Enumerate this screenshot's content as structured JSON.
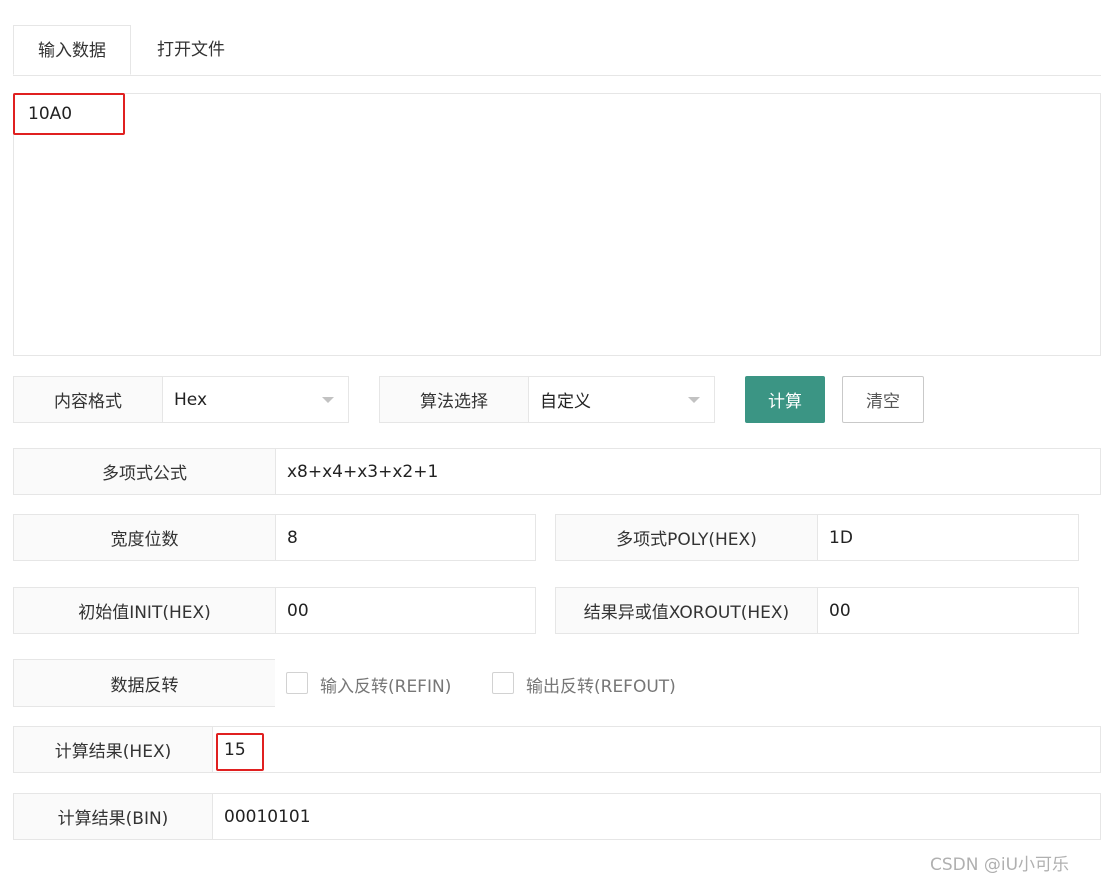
{
  "tabs": [
    {
      "label": "输入数据",
      "active": true
    },
    {
      "label": "打开文件",
      "active": false
    }
  ],
  "input": {
    "value": "10A0"
  },
  "format": {
    "label": "内容格式",
    "value": "Hex"
  },
  "algorithm": {
    "label": "算法选择",
    "value": "自定义"
  },
  "buttons": {
    "calc": "计算",
    "clear": "清空"
  },
  "polynomial": {
    "label": "多项式公式",
    "value": "x8+x4+x3+x2+1"
  },
  "width": {
    "label": "宽度位数",
    "value": "8"
  },
  "poly_hex": {
    "label": "多项式POLY(HEX)",
    "value": "1D"
  },
  "init": {
    "label": "初始值INIT(HEX)",
    "value": "00"
  },
  "xorout": {
    "label": "结果异或值XOROUT(HEX)",
    "value": "00"
  },
  "reflect": {
    "label": "数据反转",
    "refin": "输入反转(REFIN)",
    "refout": "输出反转(REFOUT)",
    "refin_checked": false,
    "refout_checked": false
  },
  "result_hex": {
    "label": "计算结果(HEX)",
    "value": "15"
  },
  "result_bin": {
    "label": "计算结果(BIN)",
    "value": "00010101"
  },
  "watermark": "CSDN @iU小可乐",
  "colors": {
    "primary": "#3b9584",
    "highlight": "#e02020"
  }
}
